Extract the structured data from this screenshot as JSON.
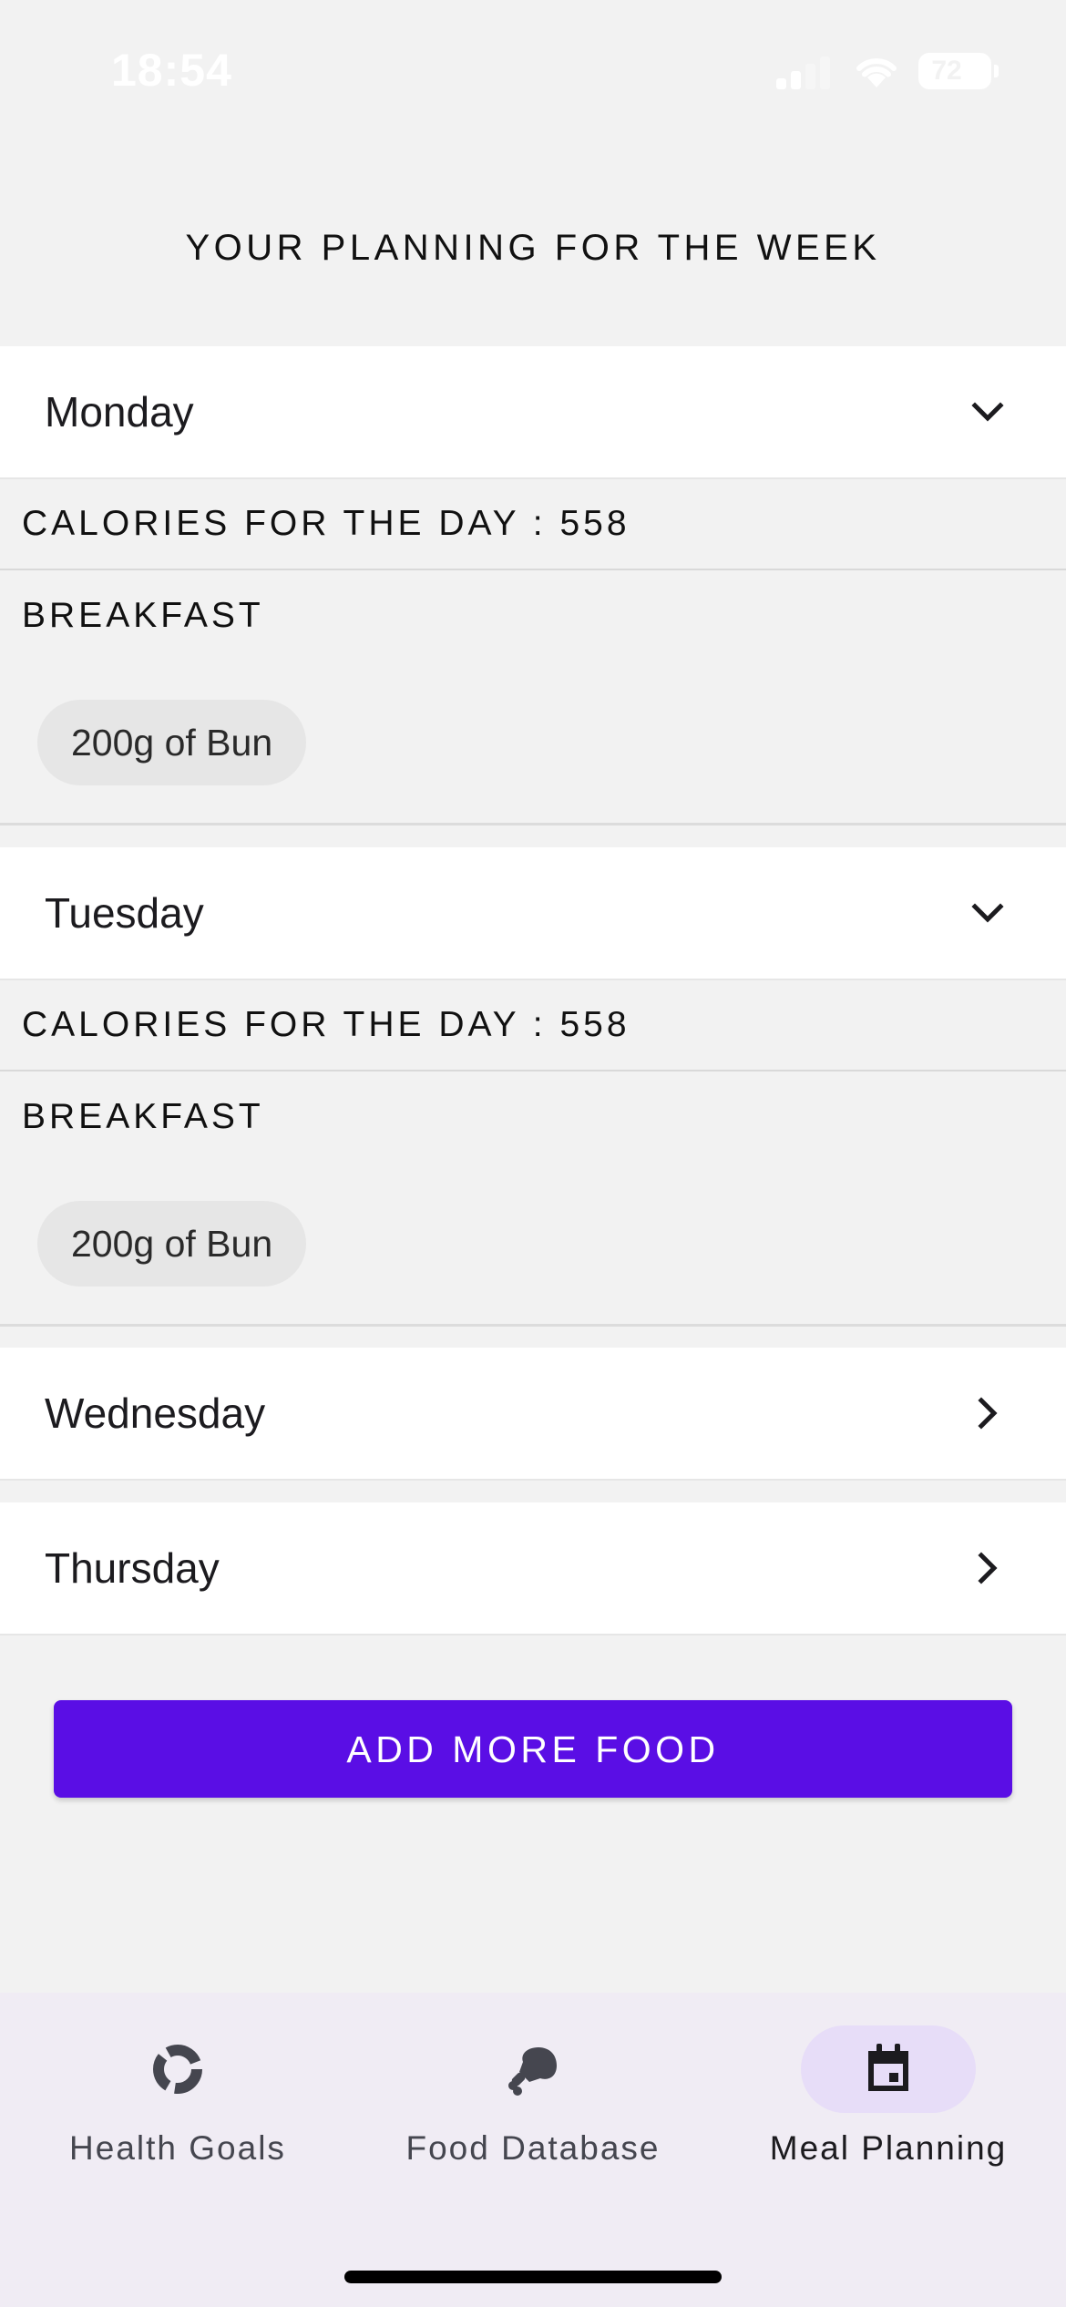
{
  "status_bar": {
    "time": "18:54",
    "battery": "72"
  },
  "page_title": "YOUR PLANNING FOR THE WEEK",
  "days": [
    {
      "name": "Monday",
      "expanded": true,
      "calories": "CALORIES FOR THE DAY : 558",
      "meal": "BREAKFAST",
      "food": "200g of Bun"
    },
    {
      "name": "Tuesday",
      "expanded": true,
      "calories": "CALORIES FOR THE DAY : 558",
      "meal": "BREAKFAST",
      "food": "200g of Bun"
    },
    {
      "name": "Wednesday",
      "expanded": false
    },
    {
      "name": "Thursday",
      "expanded": false
    }
  ],
  "add_button": "ADD MORE FOOD",
  "nav": {
    "items": [
      {
        "label": "Health Goals",
        "icon": "donut-chart-icon",
        "active": false
      },
      {
        "label": "Food Database",
        "icon": "drumstick-icon",
        "active": false
      },
      {
        "label": "Meal Planning",
        "icon": "calendar-icon",
        "active": true
      }
    ]
  },
  "colors": {
    "accent": "#5a0ee5",
    "nav_background": "#f0ecf4",
    "active_pill": "#e7ddf8",
    "page_background": "#f2f2f2"
  }
}
